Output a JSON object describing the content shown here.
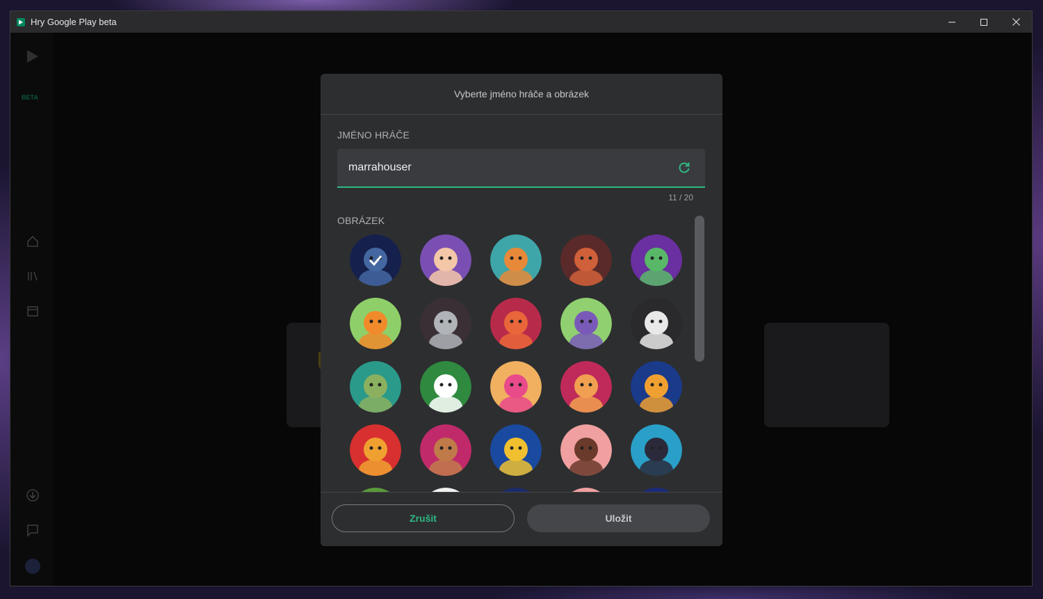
{
  "window": {
    "title": "Hry Google Play beta"
  },
  "sidebar": {
    "beta_label": "BETA"
  },
  "dialog": {
    "title": "Vyberte jméno hráče a obrázek",
    "name_label": "JMÉNO HRÁČE",
    "name_value": "marrahouser",
    "counter": "11 / 20",
    "picture_label": "OBRÁZEK",
    "cancel_label": "Zrušit",
    "save_label": "Uložit"
  },
  "avatars": [
    {
      "name": "spaceship",
      "bg": "#1e2d6b",
      "fg": "#5f8fe0",
      "selected": true
    },
    {
      "name": "unicorn",
      "bg": "#7a4fb3",
      "fg": "#f4c7a8",
      "selected": false
    },
    {
      "name": "viking",
      "bg": "#3ea6a8",
      "fg": "#e8893a",
      "selected": false
    },
    {
      "name": "werewolf",
      "bg": "#5a2a2a",
      "fg": "#d0603a",
      "selected": false
    },
    {
      "name": "zombie",
      "bg": "#6a2fa0",
      "fg": "#58b868",
      "selected": false
    },
    {
      "name": "dinosaur",
      "bg": "#8fcf6a",
      "fg": "#f08a2a",
      "selected": false
    },
    {
      "name": "sword",
      "bg": "#3a2f35",
      "fg": "#b0b3b8",
      "selected": false
    },
    {
      "name": "dragon",
      "bg": "#b82a4a",
      "fg": "#e8663a",
      "selected": false
    },
    {
      "name": "wizard",
      "bg": "#90d070",
      "fg": "#7a5ab8",
      "selected": false
    },
    {
      "name": "skull",
      "bg": "#2a2a2c",
      "fg": "#e8e8e8",
      "selected": false
    },
    {
      "name": "sloth",
      "bg": "#2a9a8a",
      "fg": "#8ab060",
      "selected": false
    },
    {
      "name": "soccer-ball",
      "bg": "#2f8a3f",
      "fg": "#ffffff",
      "selected": false
    },
    {
      "name": "cupcake",
      "bg": "#f0b060",
      "fg": "#e84a8a",
      "selected": false
    },
    {
      "name": "shiba",
      "bg": "#c02a5a",
      "fg": "#f0a050",
      "selected": false
    },
    {
      "name": "astronaut-cat",
      "bg": "#1a3a8a",
      "fg": "#f0a030",
      "selected": false
    },
    {
      "name": "burger",
      "bg": "#d83030",
      "fg": "#f0a030",
      "selected": false
    },
    {
      "name": "warrior",
      "bg": "#c02a6a",
      "fg": "#c07a4a",
      "selected": false
    },
    {
      "name": "baseball-cap",
      "bg": "#1a4aa0",
      "fg": "#f0c030",
      "selected": false
    },
    {
      "name": "rooster",
      "bg": "#f0a0a0",
      "fg": "#6a3a2a",
      "selected": false
    },
    {
      "name": "anchor",
      "bg": "#2aa0c8",
      "fg": "#2a2a3a",
      "selected": false
    },
    {
      "name": "partial-1",
      "bg": "#5a9a3a",
      "fg": "#5a9a3a",
      "selected": false
    },
    {
      "name": "partial-2",
      "bg": "#f0f0f0",
      "fg": "#f0f0f0",
      "selected": false
    },
    {
      "name": "partial-3",
      "bg": "#1a2a6a",
      "fg": "#1a2a6a",
      "selected": false
    },
    {
      "name": "partial-4",
      "bg": "#f0a0a0",
      "fg": "#f0a0a0",
      "selected": false
    },
    {
      "name": "partial-5",
      "bg": "#1a2a7a",
      "fg": "#1a2a7a",
      "selected": false
    }
  ],
  "colors": {
    "accent": "#2fb985",
    "dialog_bg": "#2d2e30"
  },
  "icons": {
    "refresh": "refresh-icon",
    "check": "check-icon"
  }
}
